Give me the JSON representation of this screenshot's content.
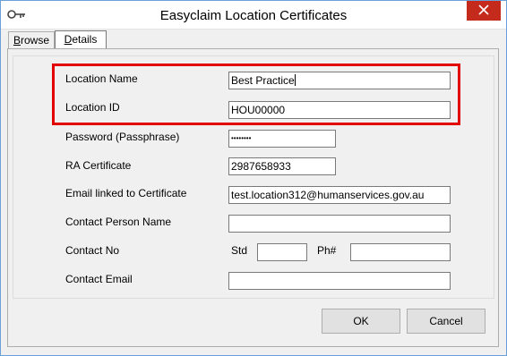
{
  "window": {
    "title": "Easyclaim Location Certificates"
  },
  "tabs": [
    {
      "label": "Browse",
      "mnemonic": "B",
      "rest": "rowse"
    },
    {
      "label": "Details",
      "mnemonic": "D",
      "rest": "etails"
    }
  ],
  "form": {
    "location_name": {
      "label": "Location Name",
      "value": "Best Practice"
    },
    "location_id": {
      "label": "Location ID",
      "value": "HOU00000"
    },
    "password": {
      "label": "Password (Passphrase)",
      "value": "••••••••"
    },
    "ra_certificate": {
      "label": "RA Certificate",
      "value": "2987658933"
    },
    "email_cert": {
      "label": "Email linked to Certificate",
      "value": "test.location312@humanservices.gov.au"
    },
    "contact_person": {
      "label": "Contact Person Name",
      "value": ""
    },
    "contact_no": {
      "label": "Contact No",
      "std_label": "Std",
      "std_value": "",
      "ph_label": "Ph#",
      "ph_value": ""
    },
    "contact_email": {
      "label": "Contact Email",
      "value": ""
    }
  },
  "buttons": {
    "ok": "OK",
    "cancel": "Cancel"
  },
  "colors": {
    "highlight": "#e30000",
    "close": "#c42b1c",
    "window_border": "#6aa0d8"
  },
  "icons": {
    "title": "key-icon",
    "close": "close-icon"
  }
}
